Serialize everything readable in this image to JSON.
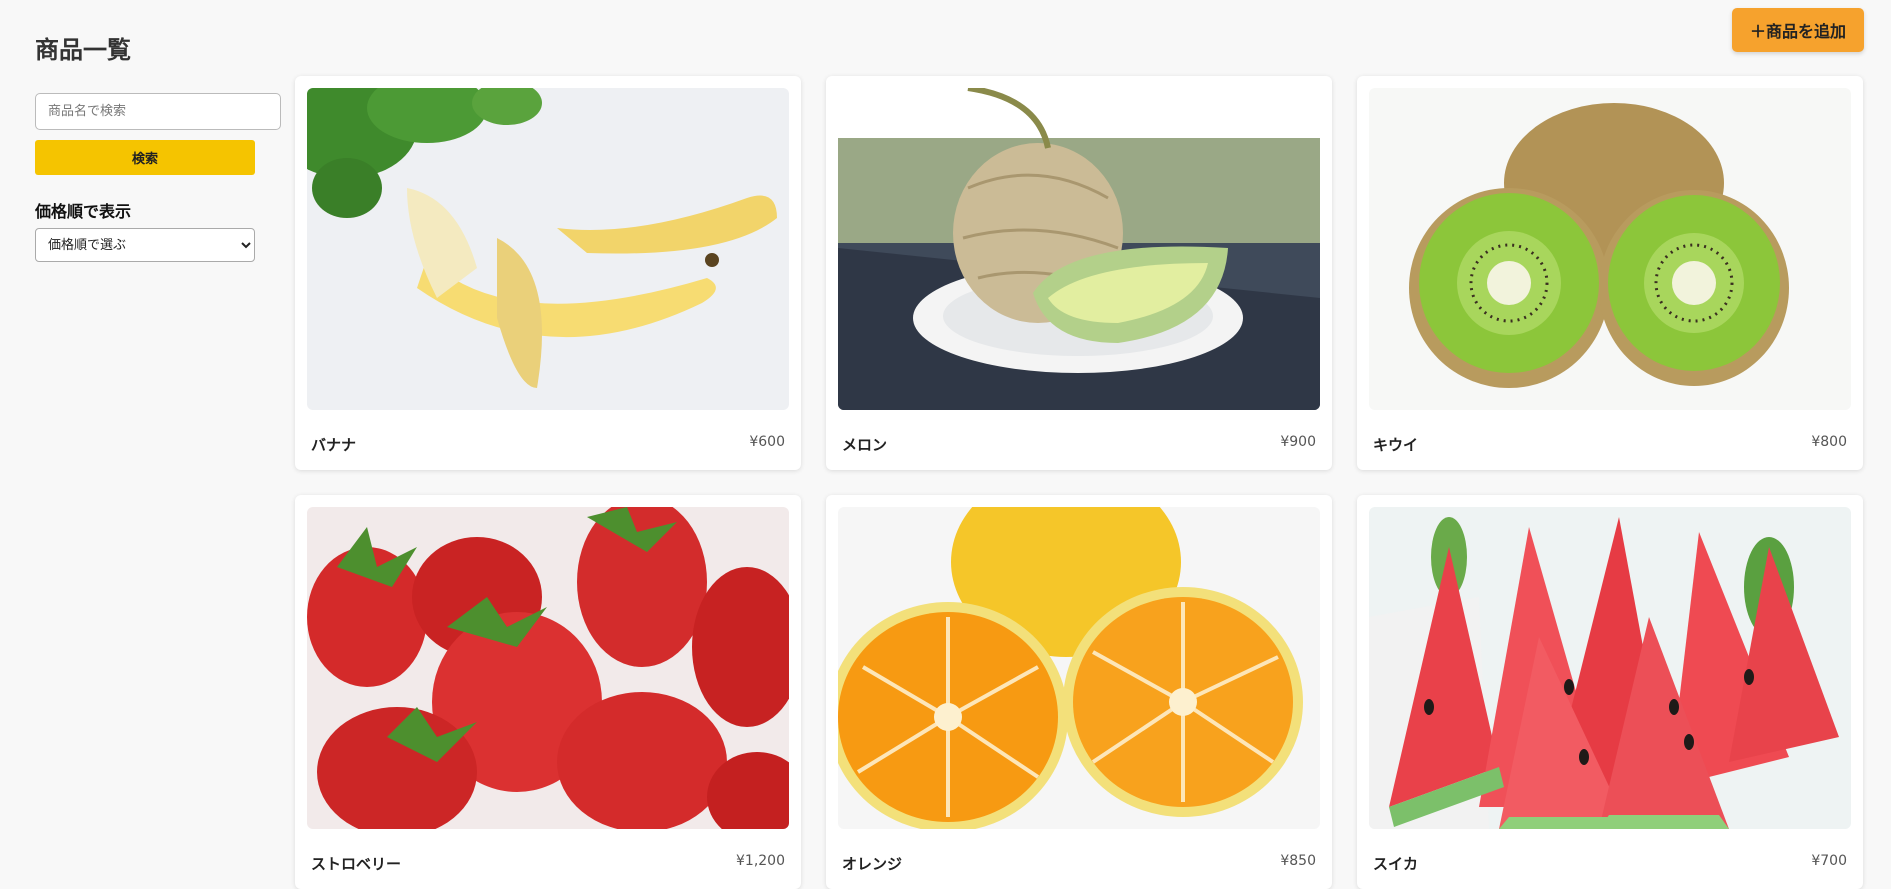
{
  "header": {
    "title": "商品一覧",
    "add_button_label": "＋商品を追加"
  },
  "sidebar": {
    "search": {
      "placeholder": "商品名で検索",
      "value": ""
    },
    "search_button_label": "検索",
    "sort_label": "価格順で表示",
    "sort_select": {
      "selected": "価格順で選ぶ"
    }
  },
  "products": [
    {
      "name": "バナナ",
      "price": "¥600",
      "image": "banana"
    },
    {
      "name": "メロン",
      "price": "¥900",
      "image": "melon"
    },
    {
      "name": "キウイ",
      "price": "¥800",
      "image": "kiwi"
    },
    {
      "name": "ストロベリー",
      "price": "¥1,200",
      "image": "strawberry"
    },
    {
      "name": "オレンジ",
      "price": "¥850",
      "image": "orange"
    },
    {
      "name": "スイカ",
      "price": "¥700",
      "image": "watermelon"
    }
  ]
}
